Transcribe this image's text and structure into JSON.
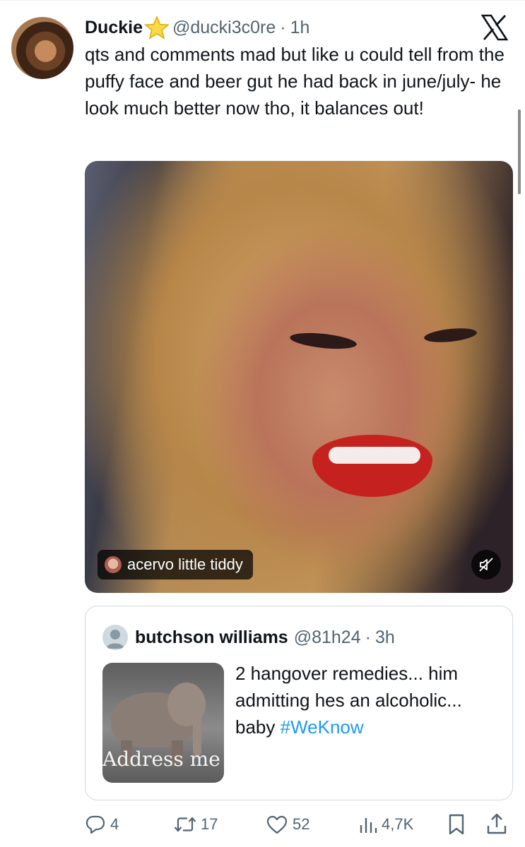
{
  "tweet": {
    "display_name": "Duckie",
    "handle": "@ducki3c0re",
    "separator": "·",
    "time": "1h",
    "text": "qts and comments mad but like u could tell from the puffy face and beer gut he had back in june/july- he look much better now tho, it balances out!"
  },
  "media": {
    "caption": "acervo little tiddy"
  },
  "quote": {
    "display_name": "butchson williams",
    "handle": "@81h24",
    "separator": "·",
    "time": "3h",
    "text_before": "2 hangover remedies... him admitting hes an alcoholic... baby ",
    "hashtag": "#WeKnow",
    "thumb_text": "Address me"
  },
  "actions": {
    "replies": "4",
    "reposts": "17",
    "likes": "52",
    "views": "4,7K"
  },
  "colors": {
    "text": "#0f1419",
    "secondary": "#536471",
    "accent": "#1d9bf0",
    "border": "#cfd9de"
  },
  "icons": [
    "star-icon",
    "x-logo-icon",
    "mute-icon",
    "reply-icon",
    "repost-icon",
    "like-icon",
    "views-icon",
    "bookmark-icon",
    "share-icon"
  ]
}
